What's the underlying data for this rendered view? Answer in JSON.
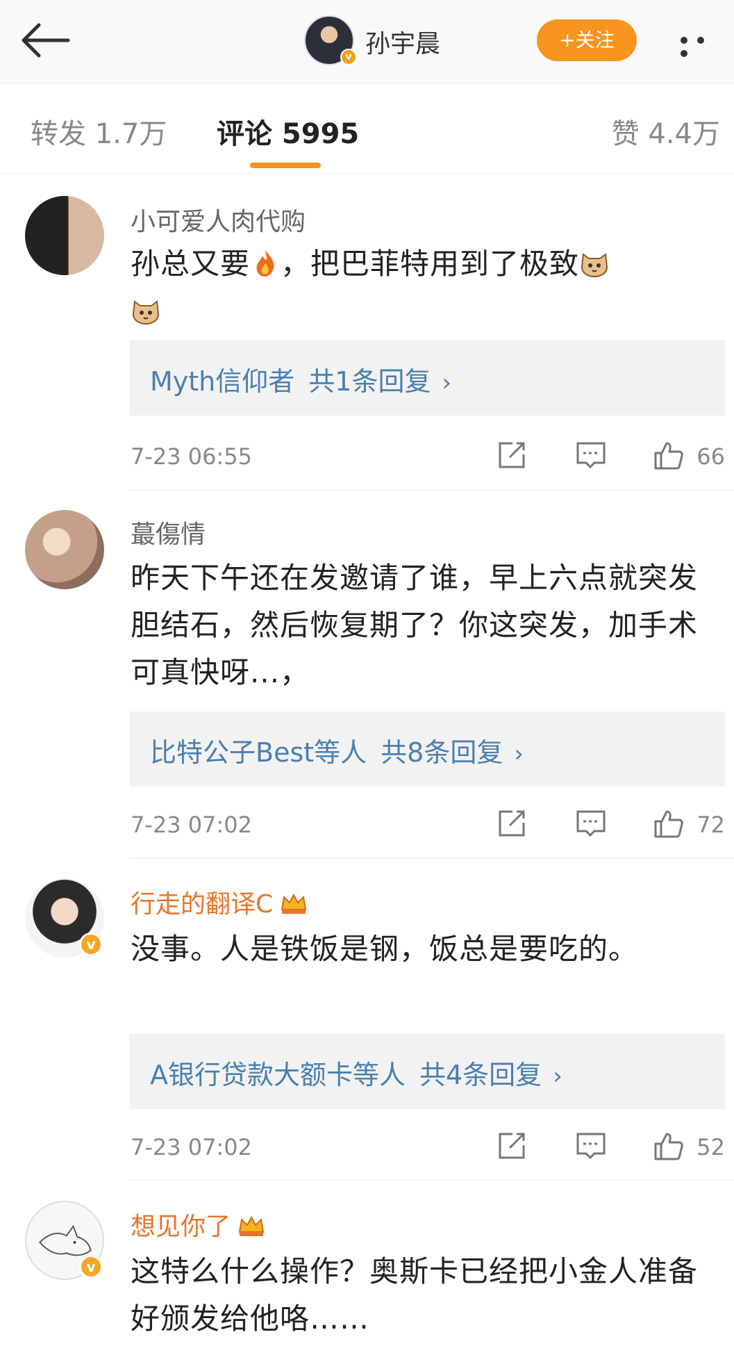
{
  "header": {
    "user_name": "孙宇晨",
    "follow_label": "+关注"
  },
  "tabs": {
    "forward": "转发 1.7万",
    "comments": "评论 5995",
    "likes": "赞 4.4万"
  },
  "comments": [
    {
      "user": "小可爱人肉代购",
      "text_a": "孙总又要",
      "text_b": "，把巴菲特用到了极致",
      "emojis": [
        "fire-emoji",
        "cat-emoji",
        "cat-emoji"
      ],
      "reply_users": "Myth信仰者",
      "reply_count": "共1条回复",
      "time": "7-23 06:55",
      "likes": "66"
    },
    {
      "user": "蕞傷情",
      "text": "昨天下午还在发邀请了谁，早上六点就突发胆结石，然后恢复期了？你这突发，加手术可真快呀...，",
      "reply_users": "比特公子Best等人",
      "reply_count": "共8条回复",
      "time": "7-23 07:02",
      "likes": "72"
    },
    {
      "user": "行走的翻译C",
      "text": "没事。人是铁饭是钢，饭总是要吃的。",
      "reply_users": "A银行贷款大额卡等人",
      "reply_count": "共4条回复",
      "time": "7-23 07:02",
      "likes": "52"
    },
    {
      "user": "想见你了",
      "text": "这特么什么操作？奥斯卡已经把小金人准备好颁发给他咯……"
    }
  ],
  "colors": {
    "accent": "#f7941d",
    "link": "#4a7fb0",
    "vip_name": "#e8742a"
  }
}
